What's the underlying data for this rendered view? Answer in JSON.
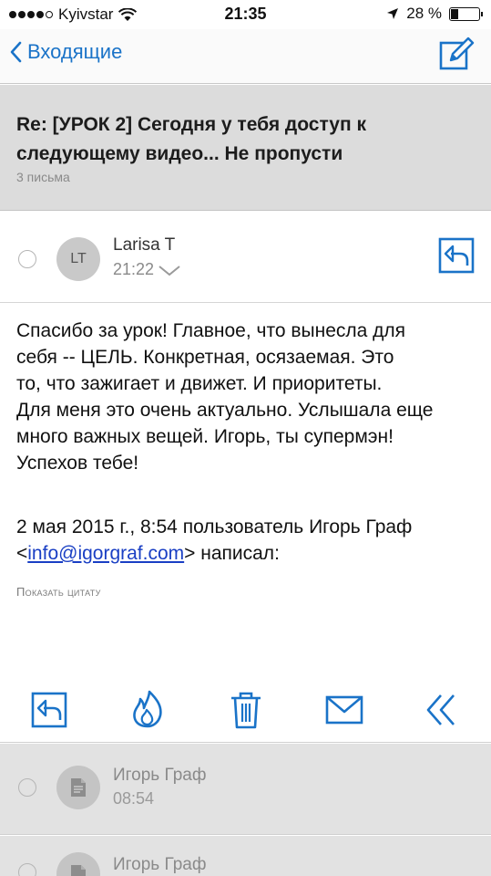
{
  "status_bar": {
    "carrier": "Kyivstar",
    "time": "21:35",
    "battery_percent": "28 %",
    "battery_level": 0.28,
    "icons": [
      "signal-dots-icon",
      "wifi-icon",
      "location-arrow-icon",
      "battery-icon"
    ]
  },
  "nav": {
    "back_label": "Входящие",
    "icons": [
      "chevron-left-icon",
      "compose-icon"
    ]
  },
  "thread": {
    "subject_line1": "Re: [УРОК 2] Сегодня у тебя доступ к",
    "subject_line2": "следующему видео... Не пропусти",
    "count_label": "3 письма"
  },
  "message": {
    "avatar_initials": "LT",
    "sender": "Larisa T",
    "time": "21:22",
    "body_lines": [
      "Спасибо за урок!  Главное, что вынесла для",
      "себя -- ЦЕЛЬ.  Конкретная, осязаемая.  Это",
      "то, что зажигает и движет.  И приоритеты.",
      "Для меня это очень актуально. Услышала еще",
      "много важных вещей.  Игорь, ты супермэн!",
      "Успехов тебе!"
    ],
    "quote_line1": "2 мая 2015 г., 8:54 пользователь Игорь Граф",
    "quote_bracket_open": "<",
    "quote_email": "info@igorgraf.com",
    "quote_suffix": "> написал:",
    "show_quote_label": "Показать цитату"
  },
  "toolbar": {
    "icons": [
      "reply-icon",
      "flame-icon",
      "trash-icon",
      "envelope-icon",
      "double-chevron-left-icon"
    ]
  },
  "thread_items": [
    {
      "sender": "Игорь Граф",
      "time": "08:54"
    },
    {
      "sender": "Игорь Граф"
    }
  ],
  "colors": {
    "accent": "#1a73c8",
    "link": "#1a3fc4",
    "subject_bg": "#dcdcdc",
    "thread_bg": "#e2e2e2"
  }
}
